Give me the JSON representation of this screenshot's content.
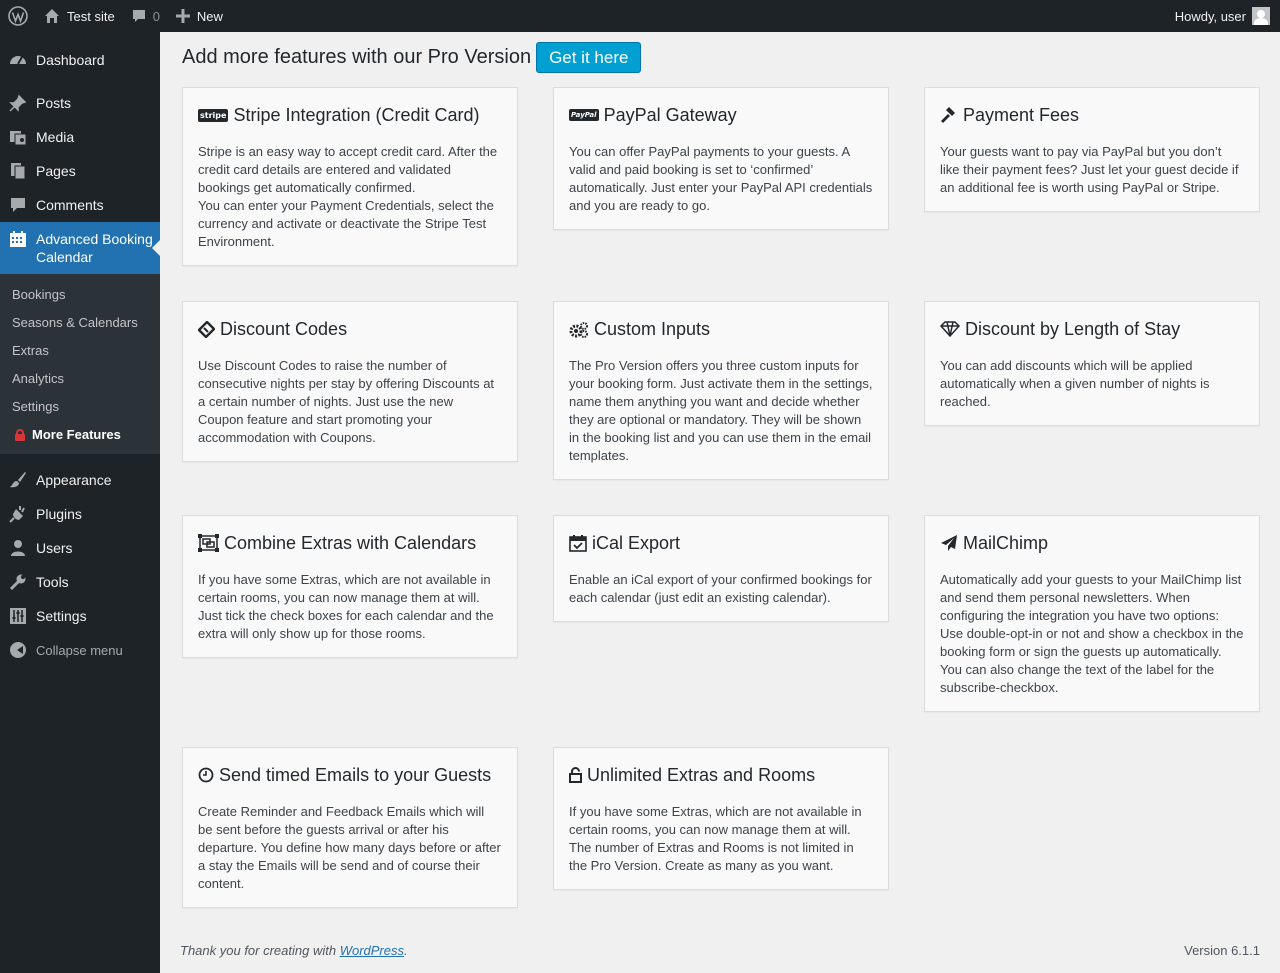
{
  "adminbar": {
    "site_name": "Test site",
    "comments_count": "0",
    "new_label": "New",
    "howdy": "Howdy, user"
  },
  "sidebar": {
    "items": [
      {
        "label": "Dashboard",
        "icon": "dashboard-icon"
      },
      {
        "label": "Posts",
        "icon": "pin-icon"
      },
      {
        "label": "Media",
        "icon": "media-icon"
      },
      {
        "label": "Pages",
        "icon": "pages-icon"
      },
      {
        "label": "Comments",
        "icon": "comment-icon"
      },
      {
        "label": "Advanced Booking Calendar",
        "icon": "calendar-icon"
      },
      {
        "label": "Appearance",
        "icon": "brush-icon"
      },
      {
        "label": "Plugins",
        "icon": "plug-icon"
      },
      {
        "label": "Users",
        "icon": "user-icon"
      },
      {
        "label": "Tools",
        "icon": "wrench-icon"
      },
      {
        "label": "Settings",
        "icon": "sliders-icon"
      }
    ],
    "submenu": [
      "Bookings",
      "Seasons & Calendars",
      "Extras",
      "Analytics",
      "Settings",
      "More Features"
    ],
    "collapse": "Collapse menu"
  },
  "main": {
    "header_title": "Add more features with our Pro Version",
    "cta_button": "Get it here",
    "cards": [
      {
        "title": "Stripe Integration (Credit Card)",
        "icon": "stripe-icon",
        "text": "Stripe is an easy way to accept credit card. After the credit card details are entered and validated bookings get automatically confirmed.\nYou can enter your Payment Credentials, select the currency and activate or deactivate the Stripe Test Environment."
      },
      {
        "title": "PayPal Gateway",
        "icon": "paypal-icon",
        "text": "You can offer PayPal payments to your guests. A valid and paid booking is set to ‘confirmed’ automatically. Just enter your PayPal API credentials and you are ready to go."
      },
      {
        "title": "Payment Fees",
        "icon": "gavel-icon",
        "text": "Your guests want to pay via PayPal but you don’t like their payment fees? Just let your guest decide if an additional fee is worth using PayPal or Stripe."
      },
      {
        "title": "Discount Codes",
        "icon": "ticket-icon",
        "text": "Use Discount Codes to raise the number of consecutive nights per stay by offering Discounts at a certain number of nights. Just use the new Coupon feature and start promoting your accommodation with Coupons."
      },
      {
        "title": "Custom Inputs",
        "icon": "cogs-icon",
        "text": "The Pro Version offers you three custom inputs for your booking form. Just activate them in the settings, name them anything you want and decide whether they are optional or mandatory. They will be shown in the booking list and you can use them in the email templates."
      },
      {
        "title": "Discount by Length of Stay",
        "icon": "diamond-icon",
        "text": "You can add discounts which will be applied automatically when a given number of nights is reached."
      },
      {
        "title": "Combine Extras with Calendars",
        "icon": "object-group-icon",
        "text": "If you have some Extras, which are not available in certain rooms, you can now manage them at will. Just tick the check boxes for each calendar and the extra will only show up for those rooms."
      },
      {
        "title": "iCal Export",
        "icon": "calendar-check-icon",
        "text": "Enable an iCal export of your confirmed bookings for each calendar (just edit an existing calendar)."
      },
      {
        "title": "MailChimp",
        "icon": "paper-plane-icon",
        "text": "Automatically add your guests to your MailChimp list and send them personal newsletters. When configuring the integration you have two options: Use double-opt-in or not and show a checkbox in the booking form or sign the guests up automatically. You can also change the text of the label for the subscribe-checkbox."
      },
      {
        "title": "Send timed Emails to your Guests",
        "icon": "clock-icon",
        "text": "Create Reminder and Feedback Emails which will be sent before the guests arrival or after his departure. You define how many days before or after a stay the Emails will be send and of course their content."
      },
      {
        "title": "Unlimited Extras and Rooms",
        "icon": "unlock-icon",
        "text": "If you have some Extras, which are not available in certain rooms, you can now manage them at will. The number of Extras and Rooms is not limited in the Pro Version. Create as many as you want."
      }
    ]
  },
  "footer": {
    "thanks_prefix": "Thank you for creating with ",
    "thanks_link": "WordPress",
    "thanks_suffix": ".",
    "version": "Version 6.1.1"
  }
}
